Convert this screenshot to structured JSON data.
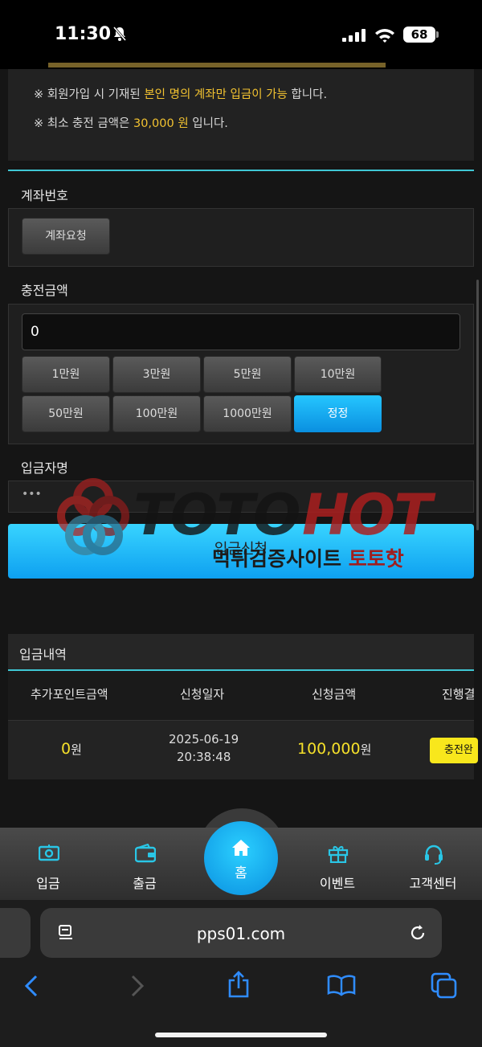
{
  "status": {
    "time": "11:30",
    "battery": "68"
  },
  "notice": {
    "line1_prefix": "※ 회원가입 시 기재된 ",
    "line1_highlight": "본인 명의 계좌만 입금이 가능",
    "line1_suffix": " 합니다.",
    "line2_prefix": "※ 최소 충전 금액은 ",
    "line2_highlight": "30,000 원",
    "line2_suffix": " 입니다."
  },
  "account": {
    "title": "계좌번호",
    "request_button": "계좌요청"
  },
  "charge": {
    "title": "충전금액",
    "amount_value": "0",
    "buttons": [
      "1만원",
      "3만원",
      "5만원",
      "10만원",
      "50만원",
      "100만원",
      "1000만원"
    ],
    "correct_button": "정정"
  },
  "depositor": {
    "title": "입금자명",
    "value": "•••"
  },
  "submit_label": "입금신청",
  "watermark": {
    "logo_part1": "TOTO",
    "logo_part2": "HOT",
    "subtitle_part1": "먹튀검증사이트 ",
    "subtitle_part2": "토토핫"
  },
  "history": {
    "title": "입금내역",
    "columns": [
      "추가포인트금액",
      "신청일자",
      "신청금액",
      "진행결"
    ],
    "rows": [
      {
        "bonus_amount": "0",
        "bonus_unit": "원",
        "date": "2025-06-19",
        "time": "20:38:48",
        "amount": "100,000",
        "amount_unit": "원",
        "status": "충전완"
      }
    ]
  },
  "bottom_nav": {
    "deposit": "입금",
    "withdraw": "출금",
    "home": "홈",
    "event": "이벤트",
    "support": "고객센터"
  },
  "browser": {
    "url": "pps01.com"
  },
  "colors": {
    "accent": "#0ea0f0",
    "highlight": "#f2c230",
    "teal": "#3fc7d4"
  }
}
